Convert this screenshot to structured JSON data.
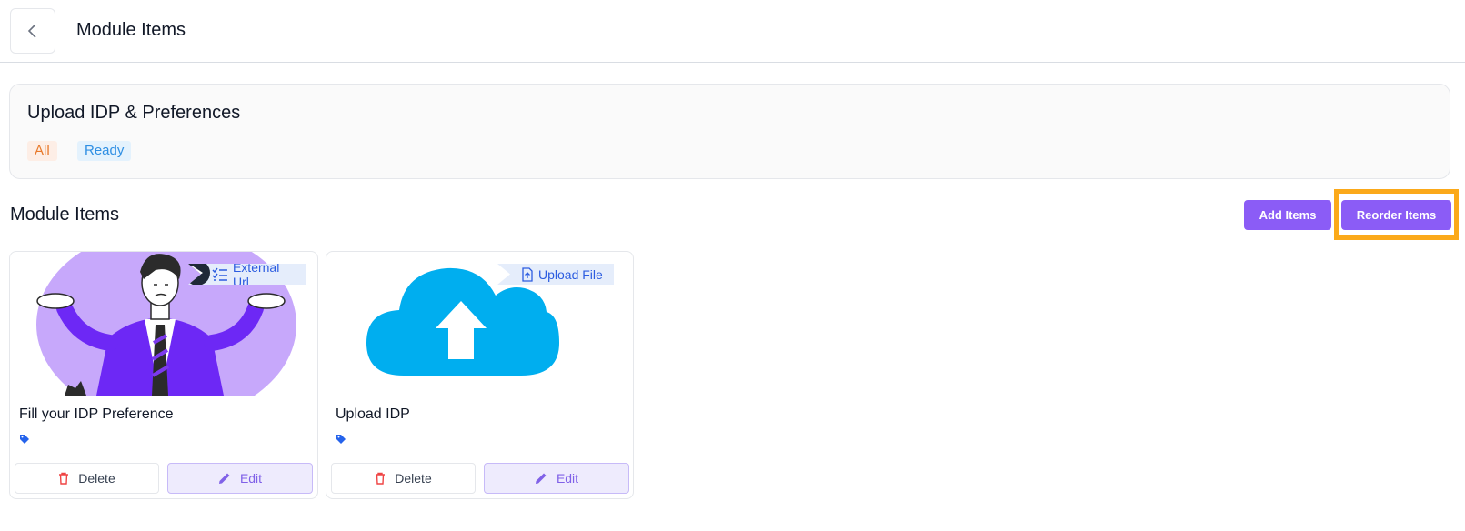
{
  "header": {
    "title": "Module Items"
  },
  "module": {
    "name": "Upload IDP & Preferences",
    "tags": [
      "All",
      "Ready"
    ]
  },
  "section": {
    "title": "Module Items",
    "add_label": "Add Items",
    "reorder_label": "Reorder Items"
  },
  "items": [
    {
      "title": "Fill your IDP Preference",
      "type": "External Url",
      "delete_label": "Delete",
      "edit_label": "Edit"
    },
    {
      "title": "Upload IDP",
      "type": "Upload File",
      "delete_label": "Delete",
      "edit_label": "Edit"
    }
  ],
  "colors": {
    "accent": "#8b5cf6",
    "highlight": "#fba91a",
    "cloud": "#00aeef",
    "tag_icon": "#2563eb",
    "delete_icon": "#ef4444"
  }
}
